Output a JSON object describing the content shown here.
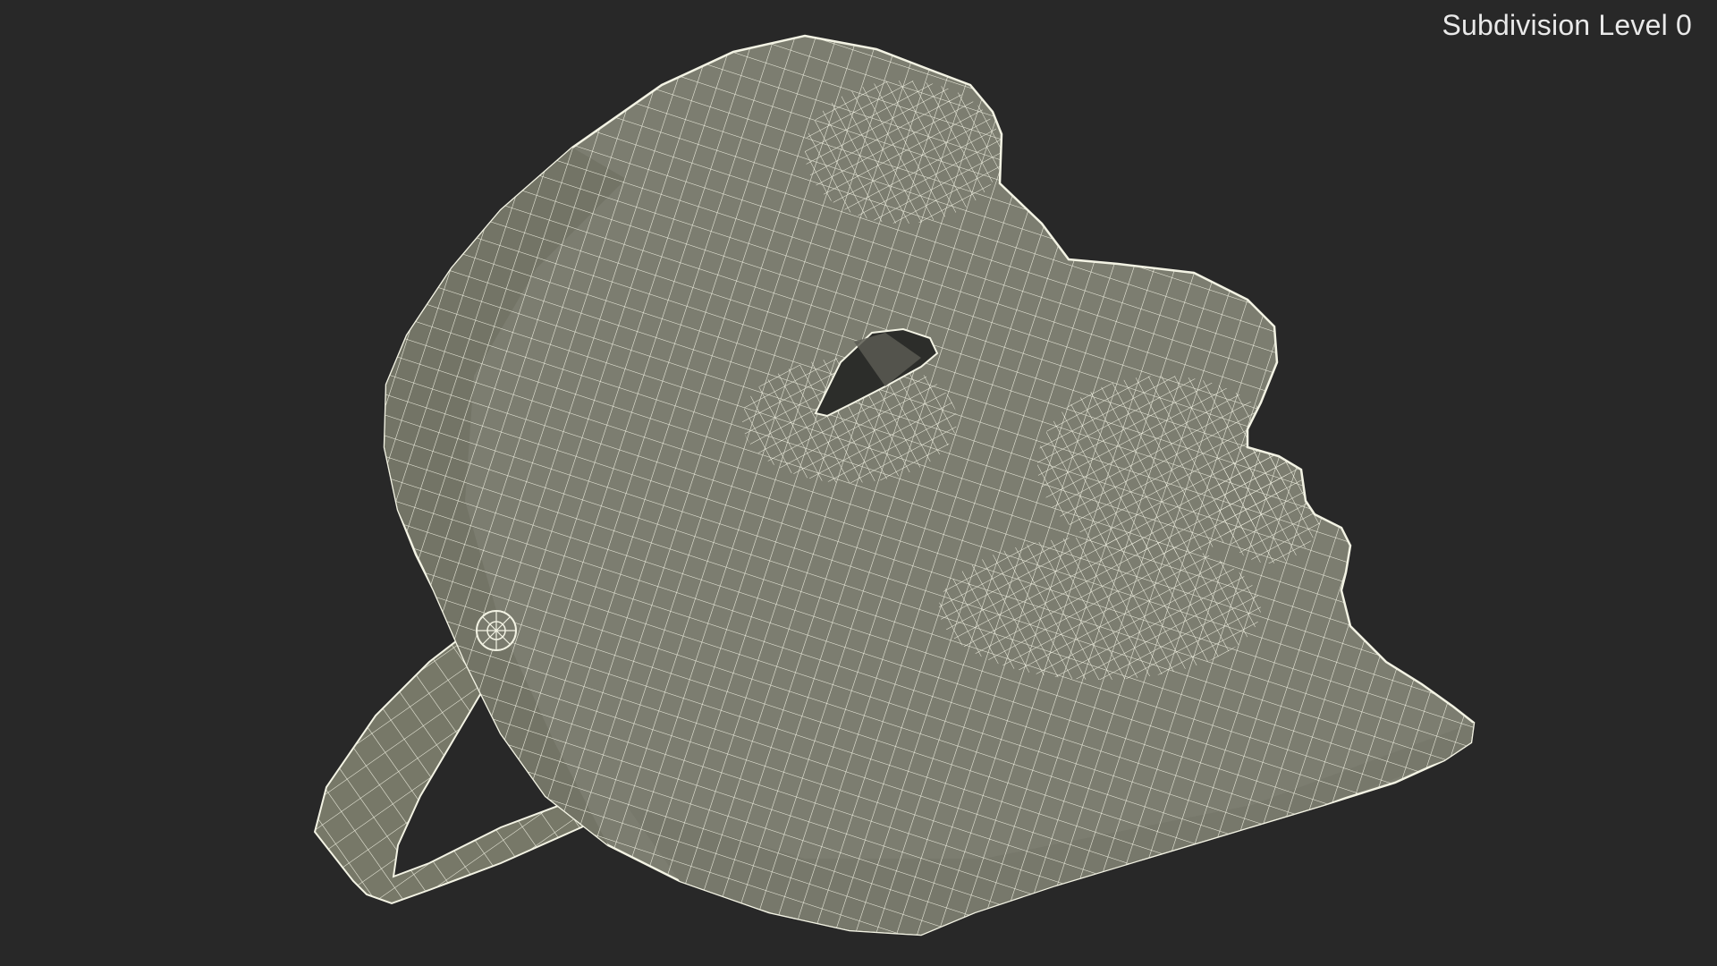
{
  "viewport": {
    "subdivision_label": "Subdivision Level 0",
    "background_color": "#282828",
    "mesh_fill_color": "#7c7d70",
    "mesh_wire_color": "#f3f3e4"
  },
  "model": {
    "icon": "mask-wireframe-model"
  }
}
